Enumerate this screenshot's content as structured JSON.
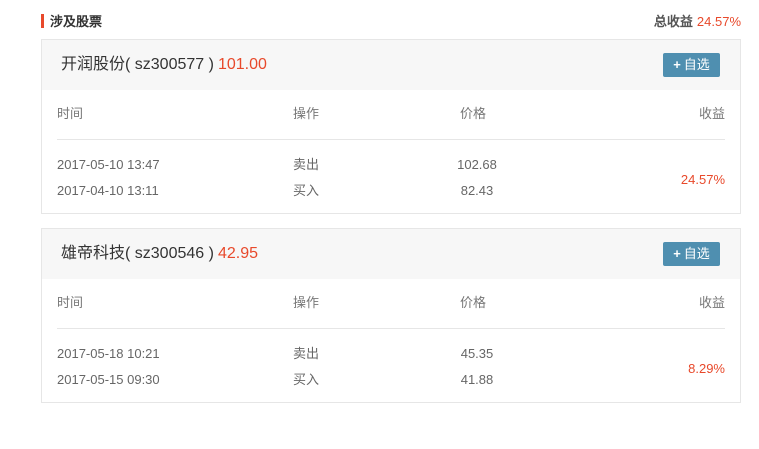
{
  "section": {
    "title": "涉及股票",
    "total_label": "总收益",
    "total_value": "24.57%"
  },
  "headers": {
    "time": "时间",
    "operation": "操作",
    "price": "价格",
    "profit": "收益"
  },
  "add_button": {
    "plus": "+",
    "label": "自选"
  },
  "stocks": [
    {
      "name": "开润股份( sz300577 )",
      "price": "101.00",
      "profit": "24.57%",
      "trades": [
        {
          "time": "2017-05-10 13:47",
          "operation": "卖出",
          "price": "102.68"
        },
        {
          "time": "2017-04-10 13:11",
          "operation": "买入",
          "price": "82.43"
        }
      ]
    },
    {
      "name": "雄帝科技( sz300546 )",
      "price": "42.95",
      "profit": "8.29%",
      "trades": [
        {
          "time": "2017-05-18 10:21",
          "operation": "卖出",
          "price": "45.35"
        },
        {
          "time": "2017-05-15 09:30",
          "operation": "买入",
          "price": "41.88"
        }
      ]
    }
  ],
  "colors": {
    "accent_red": "#e8492b",
    "button_blue": "#4f8fb0",
    "header_bg": "#f7f7f7",
    "border": "#e6e6e6"
  }
}
